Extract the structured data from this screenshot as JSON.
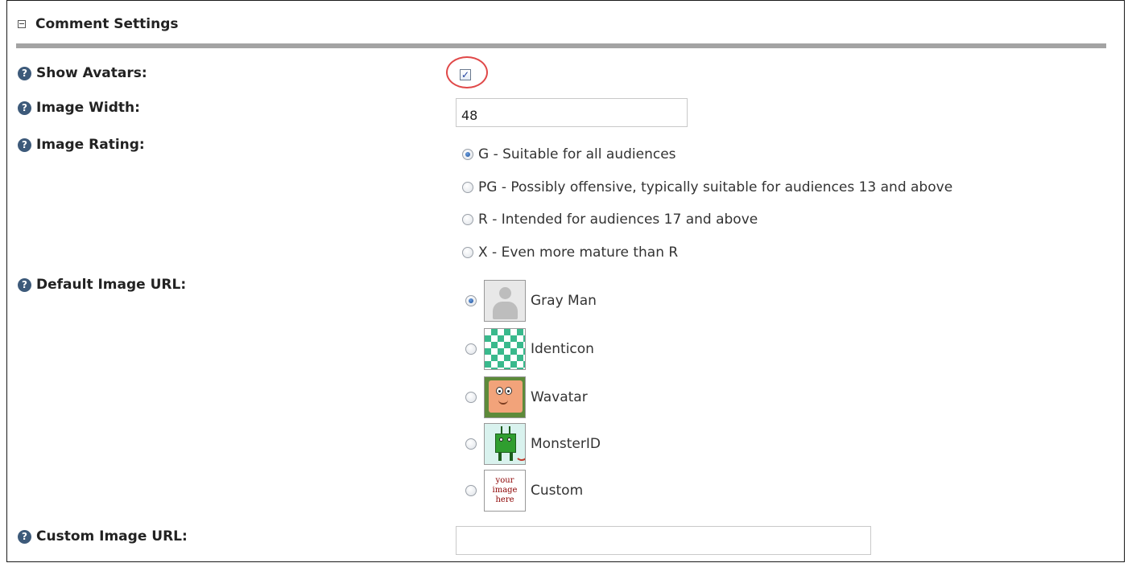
{
  "section": {
    "title": "Comment Settings"
  },
  "fields": {
    "show_avatars": {
      "label": "Show Avatars:",
      "checked": true
    },
    "image_width": {
      "label": "Image Width:",
      "value": "48"
    },
    "image_rating": {
      "label": "Image Rating:",
      "options": [
        {
          "label": "G - Suitable for all audiences",
          "checked": true
        },
        {
          "label": "PG - Possibly offensive, typically suitable for audiences 13 and above",
          "checked": false
        },
        {
          "label": "R - Intended for audiences 17 and above",
          "checked": false
        },
        {
          "label": "X - Even more mature than R",
          "checked": false
        }
      ]
    },
    "default_image_url": {
      "label": "Default Image URL:",
      "options": [
        {
          "label": "Gray Man",
          "icon": "gray-man-avatar-icon",
          "checked": true
        },
        {
          "label": "Identicon",
          "icon": "identicon-avatar-icon",
          "checked": false
        },
        {
          "label": "Wavatar",
          "icon": "wavatar-avatar-icon",
          "checked": false
        },
        {
          "label": "MonsterID",
          "icon": "monsterid-avatar-icon",
          "checked": false
        },
        {
          "label": "Custom",
          "icon": "custom-avatar-icon",
          "checked": false,
          "thumb_text": [
            "your",
            "image",
            "here"
          ]
        }
      ]
    },
    "custom_image_url": {
      "label": "Custom Image URL:",
      "value": ""
    }
  },
  "help_icon_glyph": "?",
  "checkbox_glyph": "✓",
  "colors": {
    "rule": "#a3a3a3",
    "help_icon": "#3d5a7a",
    "highlight": "#e04848",
    "identicon": "#39b98c"
  }
}
